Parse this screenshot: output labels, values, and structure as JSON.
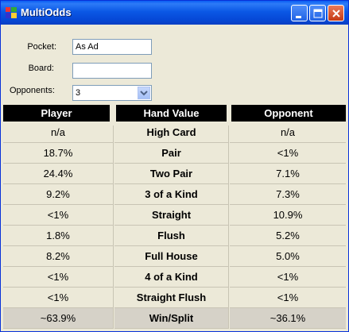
{
  "window": {
    "title": "MultiOdds"
  },
  "form": {
    "pocket_label": "Pocket:",
    "pocket_value": "As Ad",
    "board_label": "Board:",
    "board_value": "",
    "opponents_label": "Opponents:",
    "opponents_value": "3"
  },
  "table": {
    "headers": [
      "Player",
      "Hand Value",
      "Opponent"
    ],
    "rows": [
      {
        "player": "n/a",
        "hand": "High Card",
        "opponent": "n/a"
      },
      {
        "player": "18.7%",
        "hand": "Pair",
        "opponent": "<1%"
      },
      {
        "player": "24.4%",
        "hand": "Two Pair",
        "opponent": "7.1%"
      },
      {
        "player": "9.2%",
        "hand": "3 of a Kind",
        "opponent": "7.3%"
      },
      {
        "player": "<1%",
        "hand": "Straight",
        "opponent": "10.9%"
      },
      {
        "player": "1.8%",
        "hand": "Flush",
        "opponent": "5.2%"
      },
      {
        "player": "8.2%",
        "hand": "Full House",
        "opponent": "5.0%"
      },
      {
        "player": "<1%",
        "hand": "4 of a Kind",
        "opponent": "<1%"
      },
      {
        "player": "<1%",
        "hand": "Straight Flush",
        "opponent": "<1%"
      }
    ],
    "total": {
      "player": "~63.9%",
      "hand": "Win/Split",
      "opponent": "~36.1%"
    }
  },
  "icons": {
    "app": "app-icon",
    "minimize": "minimize-icon",
    "maximize": "maximize-icon",
    "close": "close-icon",
    "dropdown": "chevron-down-icon"
  }
}
